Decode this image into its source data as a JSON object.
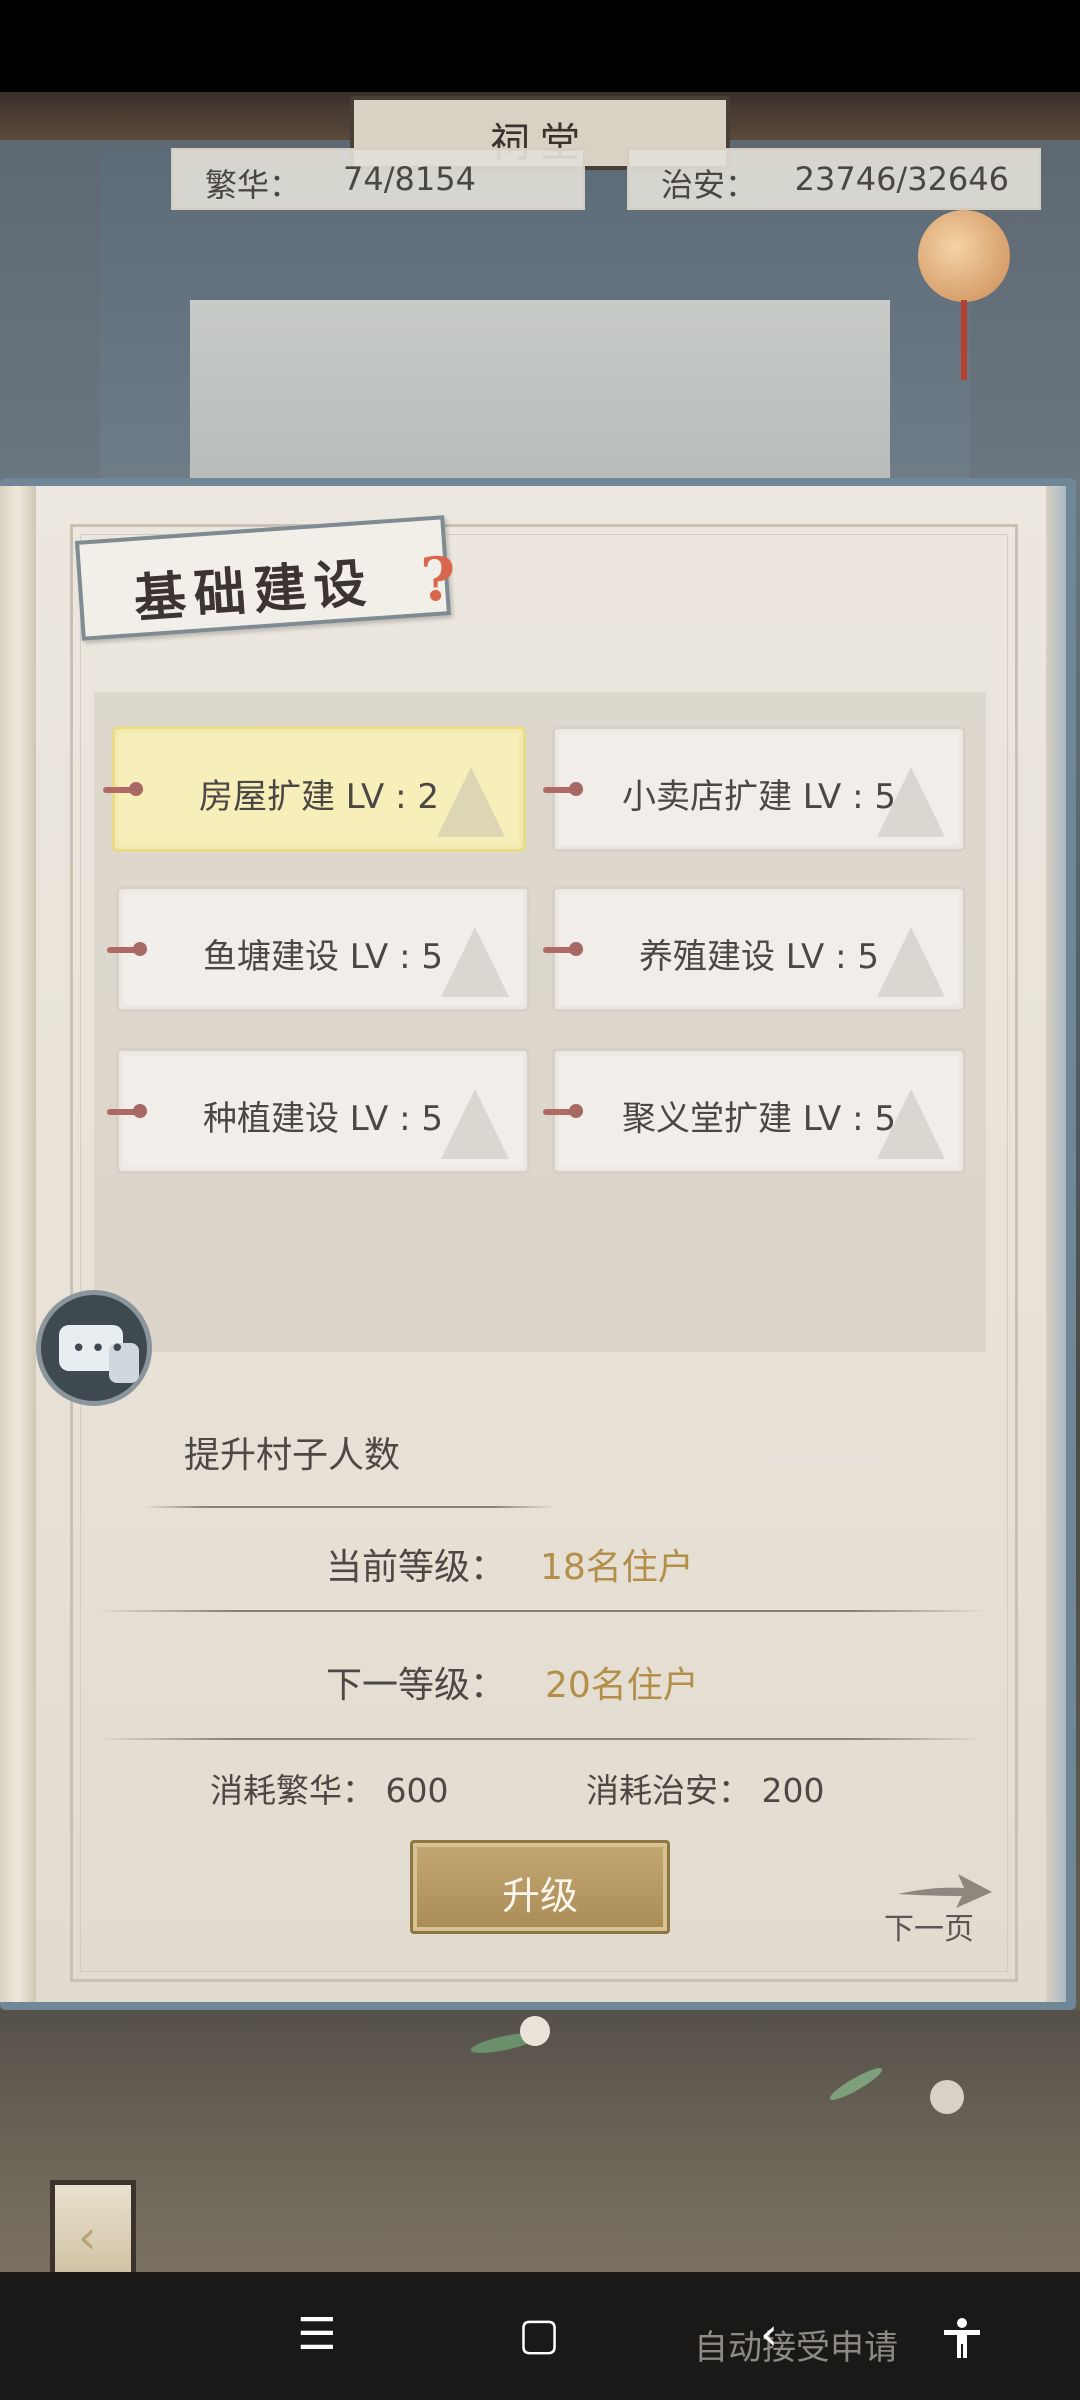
{
  "stats": {
    "prosperity_label": "繁华：",
    "prosperity_value": "74/8154",
    "security_label": "治安：",
    "security_value": "23746/32646"
  },
  "scene": {
    "hall_sign": "祠堂"
  },
  "panel": {
    "title": "基础建设",
    "help_glyph": "?"
  },
  "buildings": [
    {
      "label": "房屋扩建 LV : 2",
      "selected": true
    },
    {
      "label": "小卖店扩建 LV : 5",
      "selected": false
    },
    {
      "label": "鱼塘建设 LV : 5",
      "selected": false
    },
    {
      "label": "养殖建设 LV : 5",
      "selected": false
    },
    {
      "label": "种植建设 LV : 5",
      "selected": false
    },
    {
      "label": "聚义堂扩建 LV : 5",
      "selected": false
    }
  ],
  "detail": {
    "title": "提升村子人数",
    "current_label": "当前等级：",
    "current_value": "18名住户",
    "next_label": "下一等级：",
    "next_value": "20名住户",
    "cost_prosperity": "消耗繁华：  600",
    "cost_security": "消耗治安：  200",
    "upgrade_button": "升级",
    "next_page": "下一页"
  },
  "nav": {
    "menu_icon": "☰",
    "home_icon": "▢",
    "back_icon": "‹",
    "background_text": "自动接受申请"
  },
  "colors": {
    "accent_gold": "#b38f49",
    "selected_card": "#f6efb9",
    "upgrade_button": "#b49862"
  }
}
